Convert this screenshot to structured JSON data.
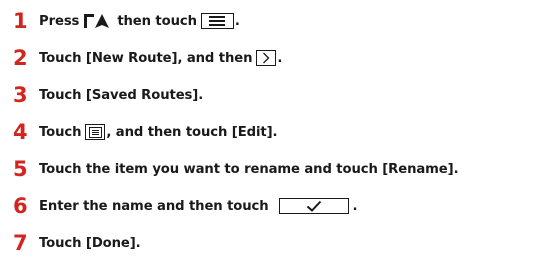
{
  "steps": [
    {
      "number": "1",
      "text_a": "Press",
      "text_b": "then touch",
      "text_c": "."
    },
    {
      "number": "2",
      "text_a": "Touch [New Route], and then",
      "text_b": "."
    },
    {
      "number": "3",
      "text_a": "Touch [Saved Routes]."
    },
    {
      "number": "4",
      "text_a": "Touch",
      "text_b": ", and then touch [Edit]."
    },
    {
      "number": "5",
      "text_a": "Touch the item you want to rename and touch [Rename]."
    },
    {
      "number": "6",
      "text_a": "Enter the name and then touch",
      "text_b": "."
    },
    {
      "number": "7",
      "text_a": "Touch [Done]."
    }
  ],
  "colors": {
    "step_number": "#d0261f",
    "text": "#1a1a1a"
  },
  "icons": {
    "step1_first": "map-position-icon",
    "step1_second": "menu-icon",
    "step2": "chevron-right-icon",
    "step4": "list-icon",
    "step6": "checkmark-icon"
  }
}
